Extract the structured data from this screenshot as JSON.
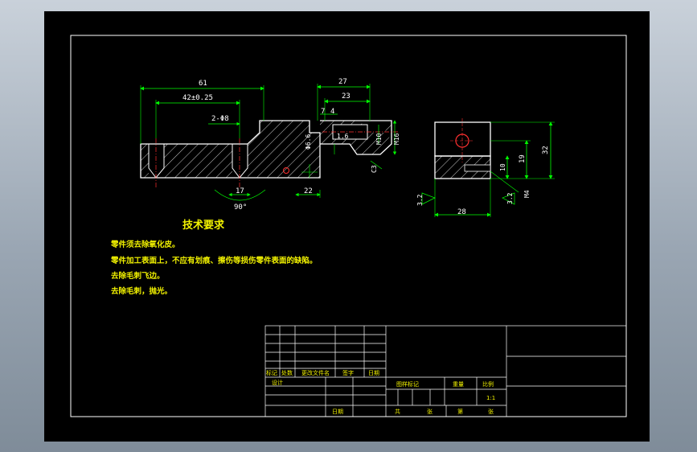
{
  "dims": {
    "d61": "61",
    "d42": "42±0.25",
    "d2m": "2-Φ8",
    "d17": "17",
    "d90": "90°",
    "d22": "22",
    "d27": "27",
    "d23": "23",
    "d7": "7",
    "d4": "4",
    "d66": "Φ6.6",
    "d16": "1.6",
    "m10": "M10",
    "m16": "M16",
    "c3": "C3",
    "d32": "32",
    "d19": "19",
    "d10": "10",
    "d28": "28",
    "m4": "M4",
    "r1": "3.2",
    "r2": "3.2"
  },
  "tech": {
    "heading": "技术要求",
    "notes": [
      "零件须去除氧化皮。",
      "零件加工表面上，不应有划痕、擦伤等损伤零件表面的缺陷。",
      "去除毛刺飞边。",
      "去除毛刺，抛光。"
    ]
  },
  "titleblock": {
    "rev_headers": [
      "标记",
      "处数",
      "更改文件名",
      "签字",
      "日期"
    ],
    "design": "设计",
    "date": "日期",
    "stage_headers": [
      "图样标记",
      "重量",
      "比例"
    ],
    "scale": "1:1",
    "sheet": [
      "共",
      "张",
      "第",
      "张"
    ]
  }
}
